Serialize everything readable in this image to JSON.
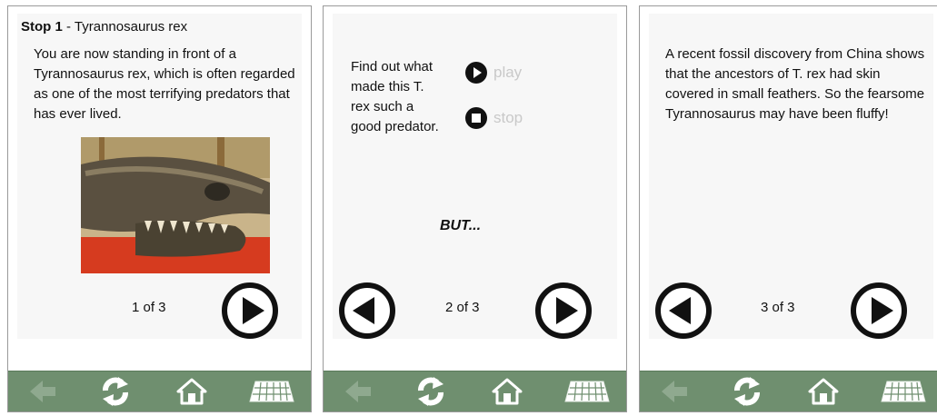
{
  "panels": [
    {
      "stop_label": "Stop 1",
      "stop_rest": " - Tyrannosaurus rex",
      "text": "You are now standing in front of a Tyrannosaurus rex, which is often regarded as one of the most terrifying predators that has ever lived.",
      "page": "1 of 3"
    },
    {
      "text": "Find out what made this T. rex such a good predator.",
      "play_label": "play",
      "stop_label": "stop",
      "but": "BUT...",
      "page": "2 of 3"
    },
    {
      "text": "A recent fossil discovery from China shows that the ancestors of T. rex had skin covered in small feathers. So the fearsome Tyrannosaurus may have been fluffy!",
      "page": "3 of 3"
    }
  ],
  "toolbar": {
    "back_icon": "back-arrow-icon",
    "sync_icon": "sync-icon",
    "home_icon": "home-icon",
    "keyboard_icon": "keyboard-icon"
  },
  "colors": {
    "toolbar": "#6f8f6f",
    "icon": "#ffffff",
    "back_icon_disabled": "#8fa98f",
    "media_disabled": "#c9c9c9",
    "button": "#111111"
  }
}
